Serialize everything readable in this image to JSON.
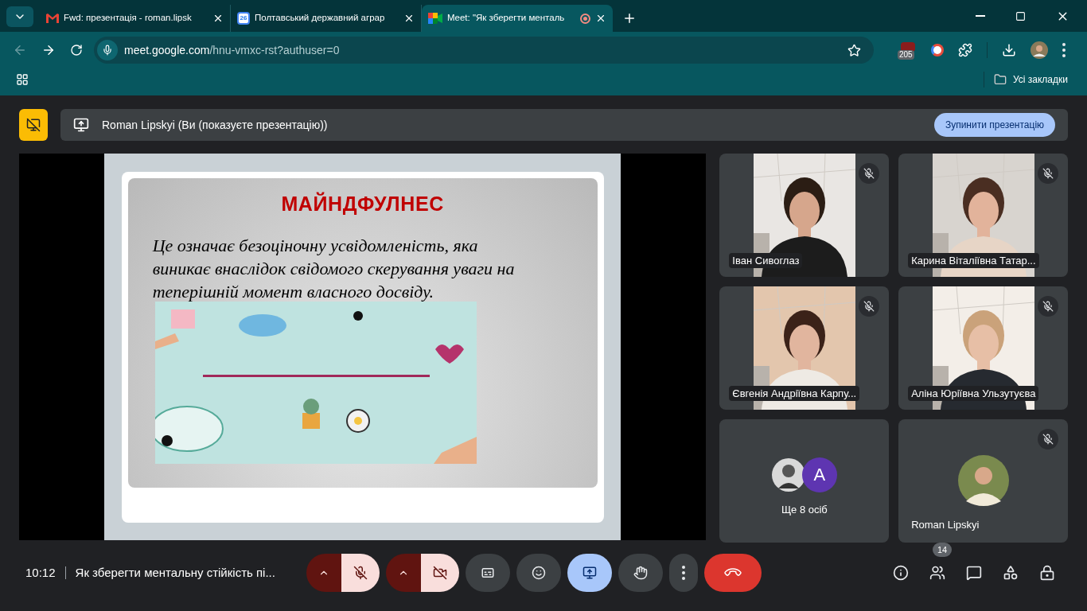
{
  "browser": {
    "tabs": [
      {
        "title": "Fwd: презентація - roman.lipsk",
        "selected": false,
        "kind": "gmail"
      },
      {
        "title": "Полтавський державний аграр",
        "selected": false,
        "kind": "calendar",
        "icon_text": "26"
      },
      {
        "title": "Meet: \"Як зберегти менталь",
        "selected": true,
        "kind": "meet",
        "recording": true
      }
    ],
    "url_host": "meet.google.com",
    "url_path": "/hnu-vmxc-rst?authuser=0",
    "back_disabled": true,
    "extension_badge": "205",
    "bookmarks_label": "Усі закладки"
  },
  "presenting_bar": {
    "label": "Roman Lipskyi (Ви (показуєте презентацію))",
    "stop_button": "Зупинити презентацію"
  },
  "slide": {
    "title": "МАЙНДФУЛНЕС",
    "lines": [
      "Це означає безоціночну усвідомленість, яка",
      "виникає внаслідок свідомого скерування уваги на",
      "теперішній момент власного досвіду."
    ]
  },
  "participants": [
    {
      "kind": "video",
      "name": "Іван Сивоглаз",
      "muted": true
    },
    {
      "kind": "video",
      "name": "Карина Віталіївна Татар...",
      "muted": true
    },
    {
      "kind": "video",
      "name": "Євгенія Андріївна Карпу...",
      "muted": true
    },
    {
      "kind": "video",
      "name": "Аліна Юріївна Ульзутуєва",
      "muted": true
    },
    {
      "kind": "others",
      "label": "Ще 8 осіб",
      "avatar_letter": "A",
      "muted": false
    },
    {
      "name": "Roman Lipskyi",
      "muted": true
    }
  ],
  "call_bar": {
    "time": "10:12",
    "meeting_title": "Як зберегти ментальну стійкість пі...",
    "controls": [
      {
        "kind": "mic",
        "on": false
      },
      {
        "kind": "camera",
        "on": false
      },
      {
        "kind": "captions",
        "on": false
      },
      {
        "kind": "emoji",
        "on": false
      },
      {
        "kind": "present",
        "on": true
      },
      {
        "kind": "hand",
        "on": false
      },
      {
        "kind": "more"
      },
      {
        "kind": "end"
      }
    ],
    "side_buttons": [
      {
        "kind": "info"
      },
      {
        "kind": "people",
        "badge": "14"
      },
      {
        "kind": "chat"
      },
      {
        "kind": "activities"
      },
      {
        "kind": "host"
      }
    ]
  }
}
